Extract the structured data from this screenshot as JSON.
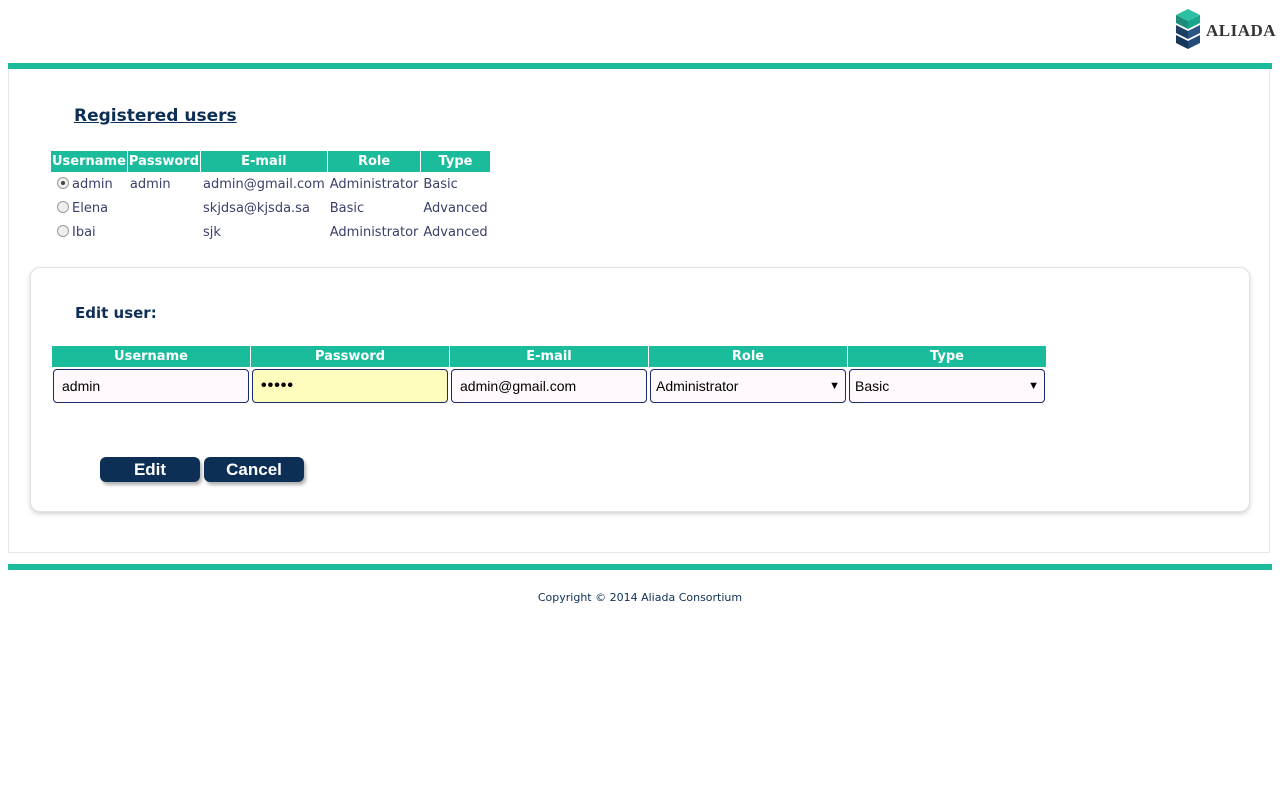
{
  "brand": {
    "logo_text": "ALIADA",
    "accent": "#1abc9c",
    "navy": "#0d2f55"
  },
  "users_title": "Registered users",
  "users_table": {
    "headers": [
      "Username",
      "Password",
      "E-mail",
      "Role",
      "Type"
    ],
    "rows": [
      {
        "selected": true,
        "username": "admin",
        "password": "admin",
        "email": "admin@gmail.com",
        "role": "Administrator",
        "type": "Basic"
      },
      {
        "selected": false,
        "username": "Elena",
        "password": "",
        "email": "skjdsa@kjsda.sa",
        "role": "Basic",
        "type": "Advanced"
      },
      {
        "selected": false,
        "username": "Ibai",
        "password": "",
        "email": "sjk",
        "role": "Administrator",
        "type": "Advanced"
      }
    ]
  },
  "edit": {
    "title": "Edit user:",
    "headers": [
      "Username",
      "Password",
      "E-mail",
      "Role",
      "Type"
    ],
    "username": "admin",
    "password": "•••••",
    "email": "admin@gmail.com",
    "role": "Administrator",
    "type": "Basic",
    "edit_label": "Edit",
    "cancel_label": "Cancel"
  },
  "footer": {
    "copyright": "Copyright © 2014 Aliada Consortium"
  }
}
